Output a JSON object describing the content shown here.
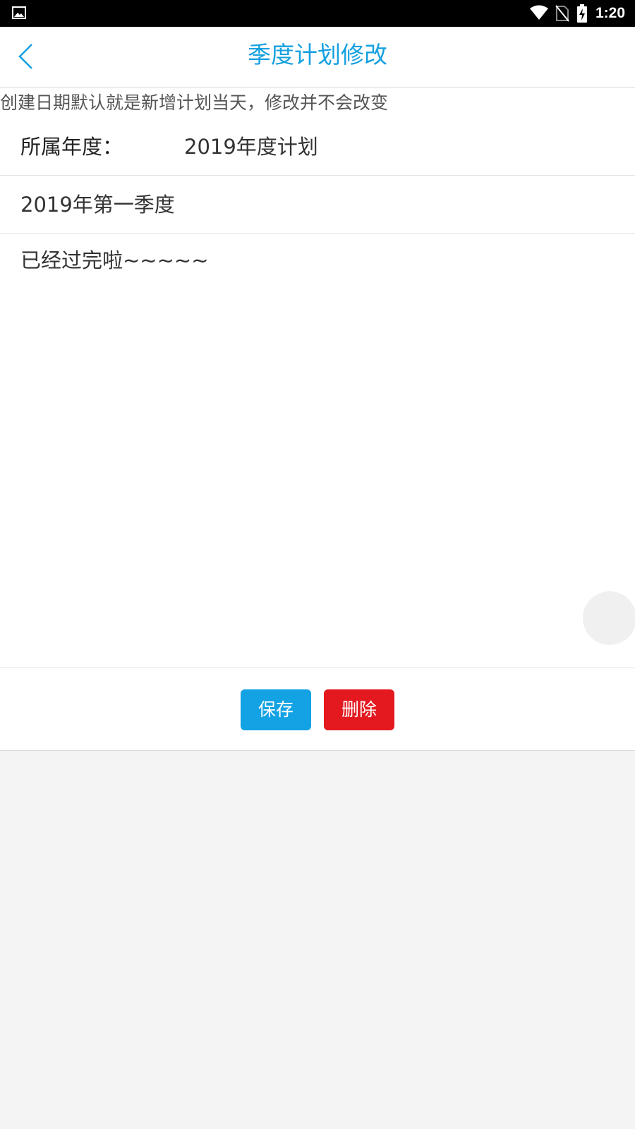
{
  "status_bar": {
    "time": "1:20",
    "icons": [
      "gallery-icon",
      "wifi-icon",
      "no-sim-icon",
      "battery-charging-icon"
    ]
  },
  "header": {
    "title": "季度计划修改",
    "back_icon": "chevron-left-icon"
  },
  "hint": "创建日期默认就是新增计划当天，修改并不会改变",
  "form": {
    "year_label": "所属年度：",
    "year_value": "2019年度计划",
    "quarter": "2019年第一季度",
    "content": "已经过完啦~~~~~"
  },
  "actions": {
    "save_label": "保存",
    "delete_label": "删除"
  },
  "colors": {
    "accent": "#14a0e0",
    "save": "#13a2e4",
    "delete": "#e3191f",
    "page_background": "#f4f4f4"
  }
}
